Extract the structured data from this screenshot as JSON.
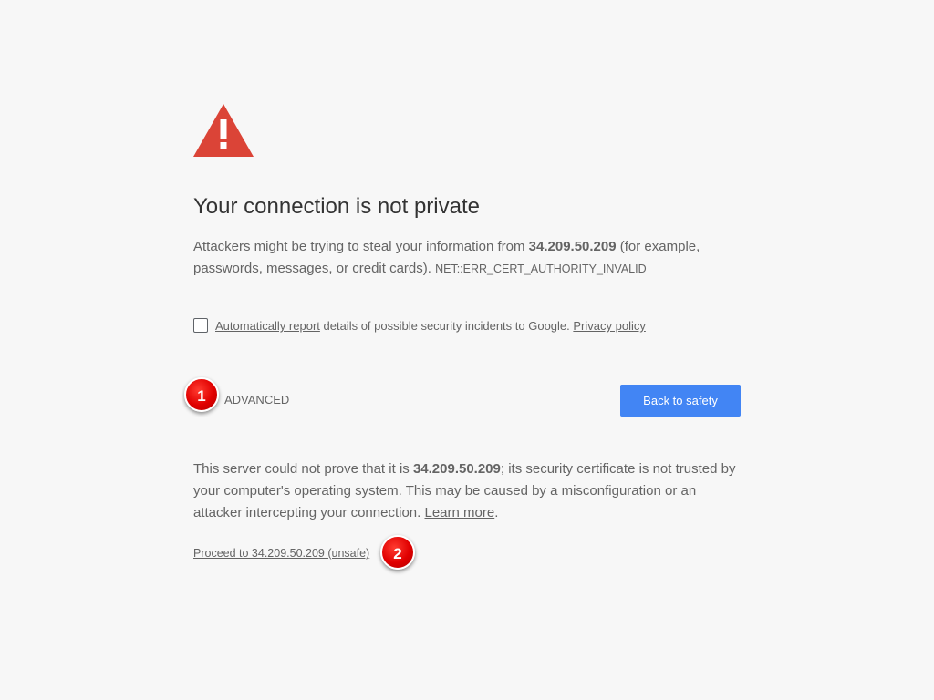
{
  "icons": {
    "warning": "warning-triangle-icon"
  },
  "colors": {
    "background": "#f7f7f7",
    "warning_red": "#db4437",
    "primary_button": "#4285f4",
    "text": "#646464",
    "title": "#333333",
    "callout_red": "#e00000"
  },
  "heading": {
    "title": "Your connection is not private"
  },
  "main_message": {
    "prefix": "Attackers might be trying to steal your information from ",
    "host": "34.209.50.209",
    "suffix": " (for example, passwords, messages, or credit cards). ",
    "error_code": "NET::ERR_CERT_AUTHORITY_INVALID"
  },
  "report": {
    "checked": false,
    "link_label": "Automatically report",
    "middle_text": " details of possible security incidents to Google. ",
    "privacy_link": "Privacy policy"
  },
  "buttons": {
    "advanced": "ADVANCED",
    "back_to_safety": "Back to safety"
  },
  "details": {
    "prefix": "This server could not prove that it is ",
    "host": "34.209.50.209",
    "suffix": "; its security certificate is not trusted by your computer's operating system. This may be caused by a misconfiguration or an attacker intercepting your connection. ",
    "learn_more": "Learn more",
    "end": "."
  },
  "proceed": {
    "label": "Proceed to 34.209.50.209 (unsafe)"
  },
  "callouts": {
    "one": "1",
    "two": "2"
  }
}
